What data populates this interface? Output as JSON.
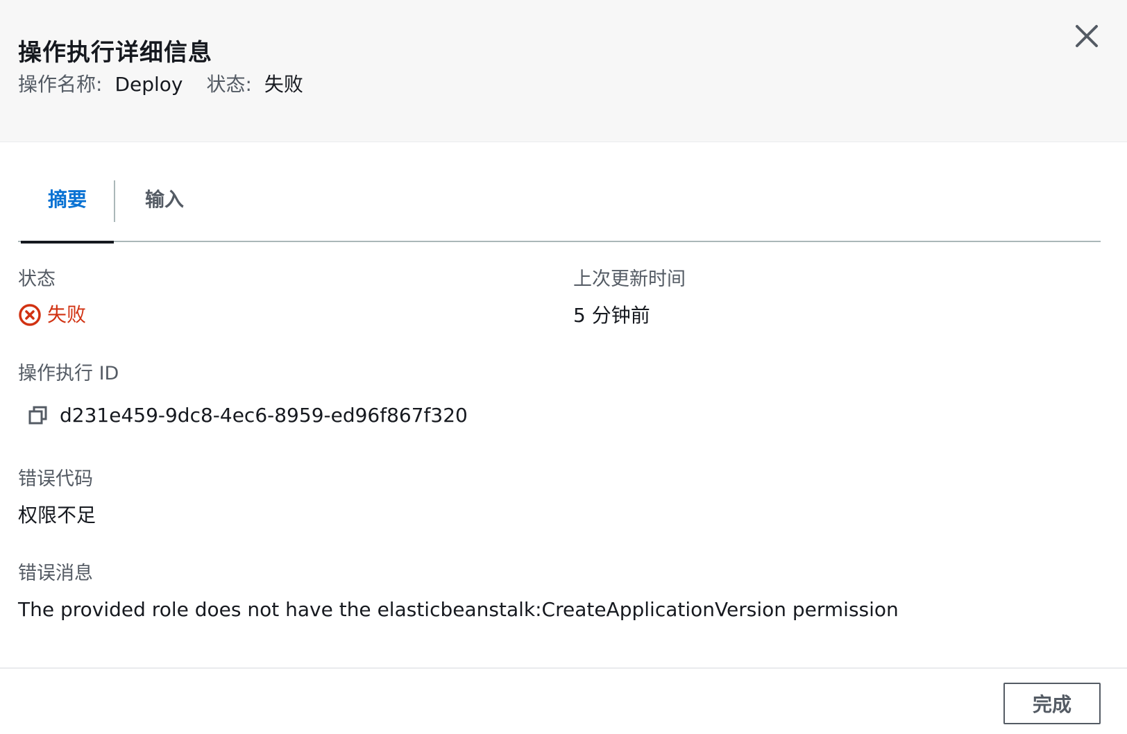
{
  "header": {
    "title": "操作执行详细信息",
    "action_name_label": "操作名称:",
    "action_name": "Deploy",
    "status_label": "状态:",
    "status": "失败",
    "close_icon": "close-icon"
  },
  "tabs": [
    {
      "label": "摘要",
      "active": true
    },
    {
      "label": "输入",
      "active": false
    }
  ],
  "summary": {
    "status_label": "状态",
    "status_value": "失败",
    "status_icon": "error-circle-icon",
    "status_color": "#d13212",
    "last_updated_label": "上次更新时间",
    "last_updated_value": "5 分钟前",
    "execution_id_label": "操作执行 ID",
    "execution_id": "d231e459-9dc8-4ec6-8959-ed96f867f320",
    "copy_icon": "copy-icon",
    "error_code_label": "错误代码",
    "error_code": "权限不足",
    "error_message_label": "错误消息",
    "error_message": "The provided role does not have the elasticbeanstalk:CreateApplicationVersion permission"
  },
  "footer": {
    "done_label": "完成"
  },
  "colors": {
    "accent": "#0972d3",
    "error": "#d13212",
    "header_bg": "#f7f7f7"
  }
}
